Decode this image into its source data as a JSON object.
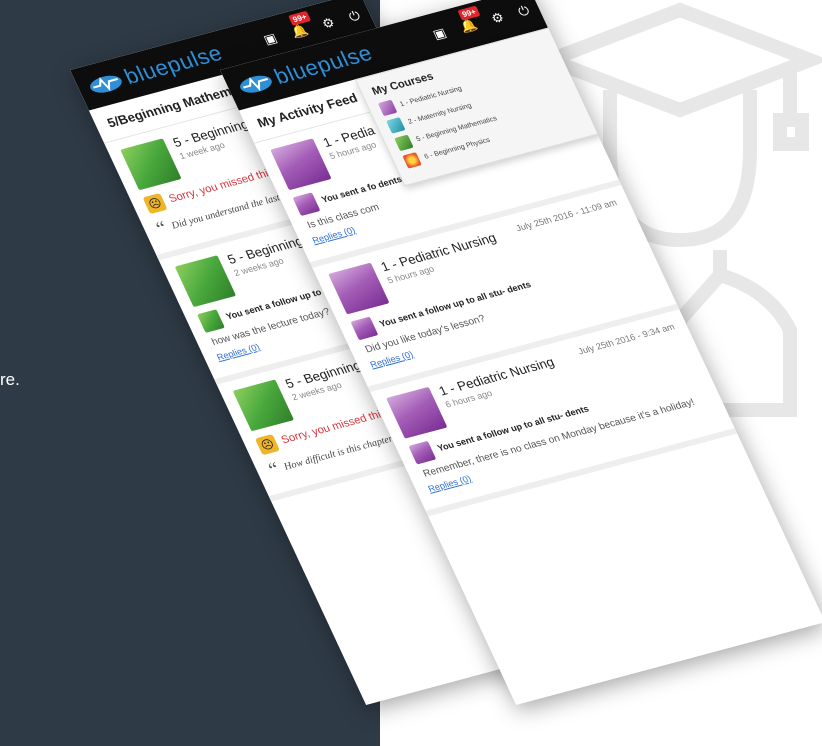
{
  "background": {
    "dark_color": "#2e3a46",
    "cut_text": "re."
  },
  "app": {
    "name": "bluepulse",
    "badge_count": "99+",
    "accent": "#2f8fd6"
  },
  "back_phone": {
    "section_title": "5/Beginning Mathematics",
    "posts": [
      {
        "title": "5 - Beginning Mathem",
        "time": "1 week ago",
        "sorry": "Sorry, you missed this que",
        "quote": "Did you understand the last"
      },
      {
        "title": "5 - Beginning Mathem",
        "time": "2 weeks ago",
        "followup": "You sent a follow up to all st dents",
        "message": "how was the lecture today?",
        "replies": "Replies (0)"
      },
      {
        "title": "5 - Beginning Mathem",
        "time": "2 weeks ago",
        "sorry": "Sorry, you missed this ques",
        "quote": "How difficult is this chapter"
      }
    ]
  },
  "front_phone": {
    "section_title": "My Activity Feed",
    "dropdown": {
      "title": "My Courses",
      "items": [
        {
          "label": "1 - Pediatric Nursing",
          "color": "#9b4db0"
        },
        {
          "label": "2 - Maternity Nursing",
          "color": "#2ab3c9"
        },
        {
          "label": "5 - Beginning Mathematics",
          "color": "#4caa3a"
        },
        {
          "label": "6 - Beginning Physics",
          "color": "#e8562a"
        }
      ]
    },
    "posts": [
      {
        "title": "1 - Pedia",
        "time": "5 hours ago",
        "followup": "You sent a fo dents",
        "message": "Is this class com",
        "replies": "Replies (0)"
      },
      {
        "title": "1 - Pediatric Nursing",
        "time": "5 hours ago",
        "date": "July 25th 2016 - 11:09 am",
        "followup": "You sent a follow up to all stu- dents",
        "message": "Did you like today's lesson?",
        "replies": "Replies (0)"
      },
      {
        "title": "1 - Pediatric Nursing",
        "time": "6 hours ago",
        "date": "July 25th 2016 - 9:34 am",
        "followup": "You sent a follow up to all stu- dents",
        "message": "Remember, there is no class on Monday because it's a holiday!",
        "replies": "Replies (0)"
      }
    ]
  }
}
